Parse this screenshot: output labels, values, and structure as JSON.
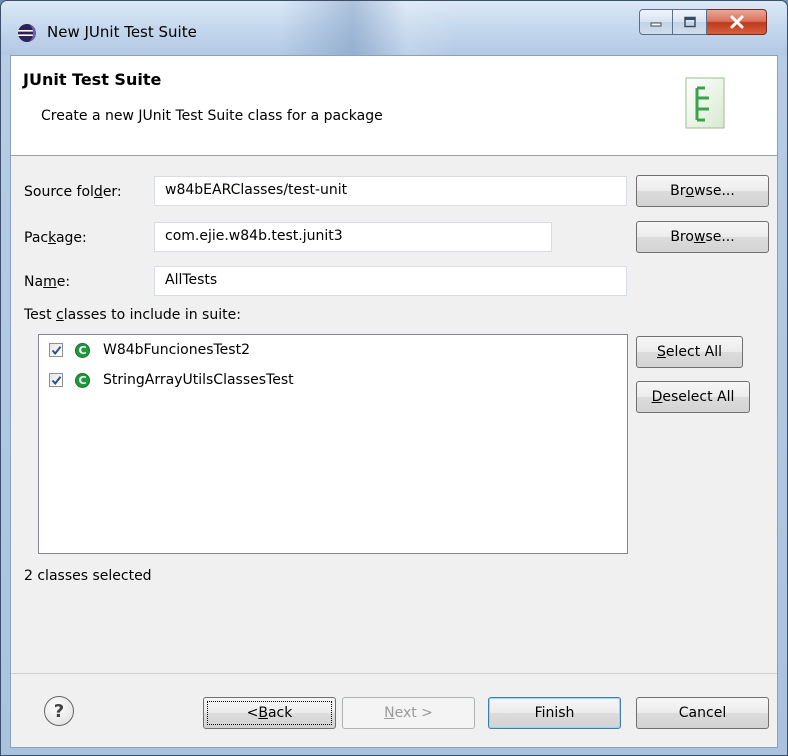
{
  "window": {
    "title": "New JUnit Test Suite"
  },
  "banner": {
    "title": "JUnit Test Suite",
    "description": "Create a new JUnit Test Suite class for a package"
  },
  "form": {
    "source_folder": {
      "label_pre": "Source fol",
      "label_key": "d",
      "label_post": "er:",
      "value": "w84bEARClasses/test-unit"
    },
    "package": {
      "label_pre": "Pac",
      "label_key": "k",
      "label_post": "age:",
      "value": "com.ejie.w84b.test.junit3"
    },
    "name": {
      "label_pre": "Na",
      "label_key": "m",
      "label_post": "e:",
      "value": "AllTests"
    },
    "browse1": {
      "pre": "Br",
      "key": "o",
      "post": "wse..."
    },
    "browse2": {
      "pre": "Bro",
      "key": "w",
      "post": "se..."
    }
  },
  "classes": {
    "label_pre": "Test ",
    "label_key": "c",
    "label_post": "lasses to include in suite:",
    "items": [
      {
        "name": "W84bFuncionesTest2",
        "checked": true,
        "icon": "class-icon"
      },
      {
        "name": "StringArrayUtilsClassesTest",
        "checked": true,
        "icon": "class-icon"
      }
    ],
    "select_all": {
      "key": "S",
      "post": "elect All"
    },
    "deselect_all": {
      "key": "D",
      "post": "eselect All"
    },
    "status": "2 classes selected"
  },
  "footer": {
    "back": {
      "pre": "< ",
      "key": "B",
      "post": "ack"
    },
    "next": {
      "key": "N",
      "post": "ext >"
    },
    "finish": "Finish",
    "cancel": "Cancel",
    "help_glyph": "?"
  },
  "colors": {
    "class_icon": "#1f9a3a",
    "close_button": "#c0391d"
  }
}
